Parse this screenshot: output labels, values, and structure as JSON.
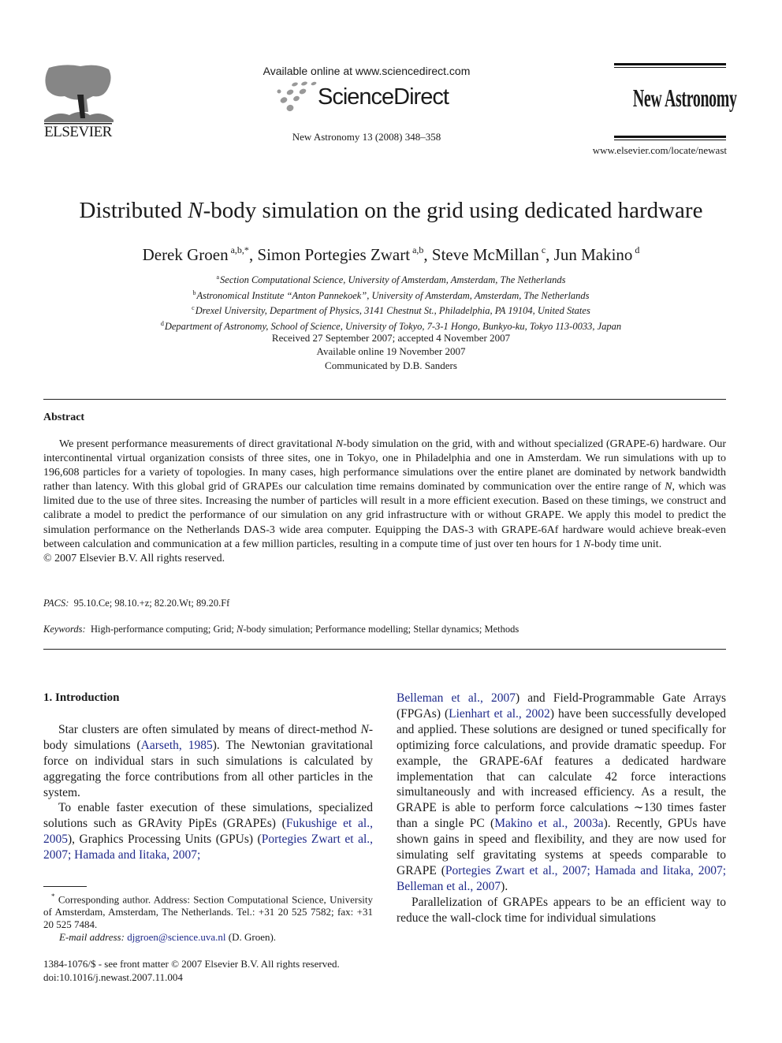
{
  "header": {
    "publisher_logo_text": "ELSEVIER",
    "available_online": "Available online at www.sciencedirect.com",
    "platform_name": "ScienceDirect",
    "journal_reference": "New Astronomy 13 (2008) 348–358",
    "journal_name": "New Astronomy",
    "journal_url": "www.elsevier.com/locate/newast"
  },
  "article": {
    "title_pre": "Distributed ",
    "title_italic": "N",
    "title_post": "-body simulation on the grid using dedicated hardware",
    "authors": [
      {
        "name": "Derek Groen",
        "sup": "a,b,*",
        "sep": ", "
      },
      {
        "name": "Simon Portegies Zwart",
        "sup": "a,b",
        "sep": ", "
      },
      {
        "name": "Steve McMillan",
        "sup": "c",
        "sep": ", "
      },
      {
        "name": "Jun Makino",
        "sup": "d",
        "sep": ""
      }
    ],
    "affiliations": [
      {
        "mark": "a",
        "text": "Section Computational Science, University of Amsterdam, Amsterdam, The Netherlands"
      },
      {
        "mark": "b",
        "text": "Astronomical Institute “Anton Pannekoek”, University of Amsterdam, Amsterdam, The Netherlands"
      },
      {
        "mark": "c",
        "text": "Drexel University, Department of Physics, 3141 Chestnut St., Philadelphia, PA 19104, United States"
      },
      {
        "mark": "d",
        "text": "Department of Astronomy, School of Science, University of Tokyo, 7-3-1 Hongo, Bunkyo-ku, Tokyo 113-0033, Japan"
      }
    ],
    "dates": {
      "received": "Received 27 September 2007; accepted 4 November 2007",
      "available": "Available online 19 November 2007",
      "communicated": "Communicated by D.B. Sanders"
    }
  },
  "abstract": {
    "heading": "Abstract",
    "segments": [
      {
        "t": "We present performance measurements of direct gravitational "
      },
      {
        "t": "N",
        "i": true
      },
      {
        "t": "-body simulation on the grid, with and without specialized (GRAPE-6) hardware. Our intercontinental virtual organization consists of three sites, one in Tokyo, one in Philadelphia and one in Amsterdam. We run simulations with up to 196,608 particles for a variety of topologies. In many cases, high performance simulations over the entire planet are dominated by network bandwidth rather than latency. With this global grid of GRAPEs our calculation time remains dominated by communication over the entire range of "
      },
      {
        "t": "N",
        "i": true
      },
      {
        "t": ", which was limited due to the use of three sites. Increasing the number of particles will result in a more efficient execution. Based on these timings, we construct and calibrate a model to predict the performance of our simulation on any grid infrastructure with or without GRAPE. We apply this model to predict the simulation performance on the Netherlands DAS-3 wide area computer. Equipping the DAS-3 with GRAPE-6Af hardware would achieve break-even between calculation and communication at a few million particles, resulting in a compute time of just over ten hours for 1 "
      },
      {
        "t": "N",
        "i": true
      },
      {
        "t": "-body time unit."
      }
    ],
    "copyright": "© 2007 Elsevier B.V. All rights reserved."
  },
  "pacs": {
    "label": "PACS:",
    "value": "95.10.Ce; 98.10.+z; 82.20.Wt; 89.20.Ff"
  },
  "keywords": {
    "label": "Keywords:",
    "segments": [
      {
        "t": "High-performance computing; Grid; "
      },
      {
        "t": "N",
        "i": true
      },
      {
        "t": "-body simulation; Performance modelling; Stellar dynamics; Methods"
      }
    ]
  },
  "intro": {
    "heading": "1. Introduction",
    "para1": [
      {
        "t": "Star clusters are often simulated by means of direct-method "
      },
      {
        "t": "N",
        "i": true
      },
      {
        "t": "-body simulations ("
      },
      {
        "t": "Aarseth, 1985",
        "c": true
      },
      {
        "t": "). The Newtonian gravitational force on individual stars in such simulations is calculated by aggregating the force contributions from all other particles in the system."
      }
    ],
    "para2": [
      {
        "t": "To enable faster execution of these simulations, specialized solutions such as GRAvity PipEs (GRAPEs) ("
      },
      {
        "t": "Fukushige et al., 2005",
        "c": true
      },
      {
        "t": "), Graphics Processing Units (GPUs) ("
      },
      {
        "t": "Portegies Zwart et al., 2007; Hamada and Iitaka, 2007;",
        "c": true
      },
      {
        "t": " "
      },
      {
        "t": "Belleman et al., 2007",
        "c": true
      },
      {
        "t": ") and Field-Programmable Gate Arrays (FPGAs) ("
      },
      {
        "t": "Lienhart et al., 2002",
        "c": true
      },
      {
        "t": ") have been successfully developed and applied. These solutions are designed or tuned specifically for optimizing force calculations, and provide dramatic speedup. For example, the GRAPE-6Af features a dedicated hardware implementation that can calculate 42 force interactions simultaneously and with increased efficiency. As a result, the GRAPE is able to perform force calculations ∼130 times faster than a single PC ("
      },
      {
        "t": "Makino et al., 2003a",
        "c": true
      },
      {
        "t": "). Recently, GPUs have shown gains in speed and flexibility, and they are now used for simulating self gravitating systems at speeds comparable to GRAPE ("
      },
      {
        "t": "Portegies Zwart et al., 2007; Hamada and Iitaka, 2007; Belleman et al., 2007",
        "c": true
      },
      {
        "t": ")."
      }
    ],
    "para3": [
      {
        "t": "Parallelization of GRAPEs appears to be an efficient way to reduce the wall-clock time for individual simulations"
      }
    ]
  },
  "footnote": {
    "mark": "*",
    "text": "Corresponding author. Address: Section Computational Science, University of Amsterdam, Amsterdam, The Netherlands. Tel.: +31 20 525 7582; fax: +31 20 525 7484.",
    "email_label": "E-mail address:",
    "email": "djgroen@science.uva.nl",
    "email_suffix": " (D. Groen)."
  },
  "front_matter": {
    "issn_line": "1384-1076/$ - see front matter © 2007 Elsevier B.V. All rights reserved.",
    "doi": "doi:10.1016/j.newast.2007.11.004"
  },
  "colors": {
    "citation_link": "#1f2a8a",
    "text": "#1a1a1a"
  }
}
